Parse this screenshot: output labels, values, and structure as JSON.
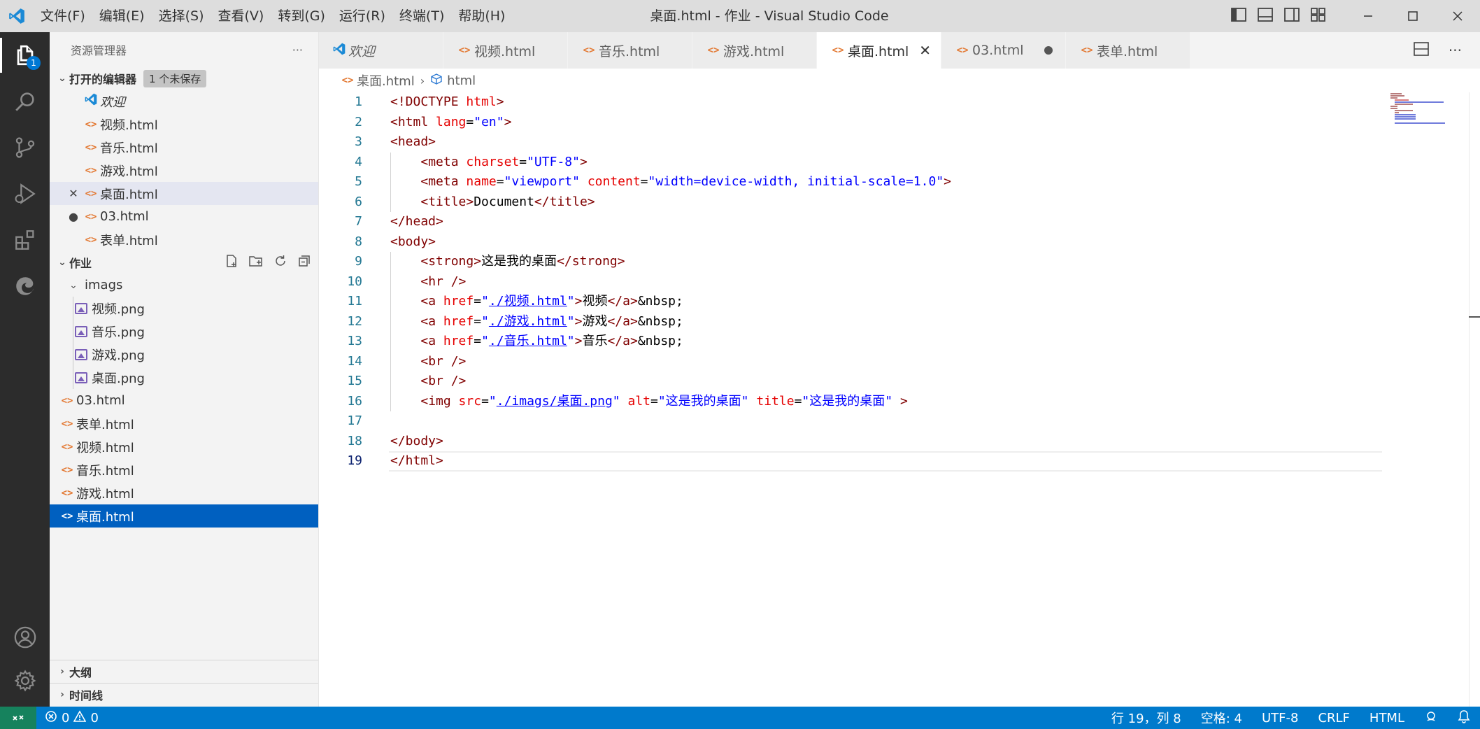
{
  "window": {
    "title": "桌面.html - 作业 - Visual Studio Code",
    "menu": [
      "文件(F)",
      "编辑(E)",
      "选择(S)",
      "查看(V)",
      "转到(G)",
      "运行(R)",
      "终端(T)",
      "帮助(H)"
    ]
  },
  "activity": {
    "explorer_badge": "1"
  },
  "sidebar": {
    "header": "资源管理器",
    "more": "···",
    "open_editors": {
      "title": "打开的编辑器",
      "badge": "1 个未保存",
      "items": [
        {
          "label": "欢迎",
          "type": "welcome"
        },
        {
          "label": "视频.html",
          "type": "html"
        },
        {
          "label": "音乐.html",
          "type": "html"
        },
        {
          "label": "游戏.html",
          "type": "html"
        },
        {
          "label": "桌面.html",
          "type": "html",
          "state": "close"
        },
        {
          "label": "03.html",
          "type": "html",
          "state": "dirty"
        },
        {
          "label": "表单.html",
          "type": "html"
        }
      ]
    },
    "workspace": {
      "title": "作业",
      "folder": "imags",
      "images": [
        "视频.png",
        "音乐.png",
        "游戏.png",
        "桌面.png"
      ],
      "files": [
        "03.html",
        "表单.html",
        "视频.html",
        "音乐.html",
        "游戏.html",
        "桌面.html"
      ]
    },
    "outline": "大纲",
    "timeline": "时间线"
  },
  "tabs": [
    {
      "label": "欢迎",
      "type": "welcome"
    },
    {
      "label": "视频.html",
      "type": "html"
    },
    {
      "label": "音乐.html",
      "type": "html"
    },
    {
      "label": "游戏.html",
      "type": "html"
    },
    {
      "label": "桌面.html",
      "type": "html",
      "active": true
    },
    {
      "label": "03.html",
      "type": "html",
      "dirty": true
    },
    {
      "label": "表单.html",
      "type": "html"
    }
  ],
  "breadcrumb": {
    "file": "桌面.html",
    "symbol": "html"
  },
  "editor": {
    "current_line": 19,
    "lines": [
      [
        [
          "t-tag",
          "<!DOCTYPE "
        ],
        [
          "t-attr",
          "html"
        ],
        [
          "t-tag",
          ">"
        ]
      ],
      [
        [
          "t-tag",
          "<html "
        ],
        [
          "t-attr",
          "lang"
        ],
        [
          "t-txt",
          "="
        ],
        [
          "t-str",
          "\"en\""
        ],
        [
          "t-tag",
          ">"
        ]
      ],
      [
        [
          "t-tag",
          "<head>"
        ]
      ],
      [
        [
          "t-txt",
          "    "
        ],
        [
          "t-tag",
          "<meta "
        ],
        [
          "t-attr",
          "charset"
        ],
        [
          "t-txt",
          "="
        ],
        [
          "t-str",
          "\"UTF-8\""
        ],
        [
          "t-tag",
          ">"
        ]
      ],
      [
        [
          "t-txt",
          "    "
        ],
        [
          "t-tag",
          "<meta "
        ],
        [
          "t-attr",
          "name"
        ],
        [
          "t-txt",
          "="
        ],
        [
          "t-str",
          "\"viewport\""
        ],
        [
          "t-txt",
          " "
        ],
        [
          "t-attr",
          "content"
        ],
        [
          "t-txt",
          "="
        ],
        [
          "t-str",
          "\"width=device-width, initial-scale=1.0\""
        ],
        [
          "t-tag",
          ">"
        ]
      ],
      [
        [
          "t-txt",
          "    "
        ],
        [
          "t-tag",
          "<title>"
        ],
        [
          "t-txt",
          "Document"
        ],
        [
          "t-tag",
          "</title>"
        ]
      ],
      [
        [
          "t-tag",
          "</head>"
        ]
      ],
      [
        [
          "t-tag",
          "<body>"
        ]
      ],
      [
        [
          "t-txt",
          "    "
        ],
        [
          "t-tag",
          "<strong>"
        ],
        [
          "t-txt",
          "这是我的桌面"
        ],
        [
          "t-tag",
          "</strong>"
        ]
      ],
      [
        [
          "t-txt",
          "    "
        ],
        [
          "t-tag",
          "<hr />"
        ]
      ],
      [
        [
          "t-txt",
          "    "
        ],
        [
          "t-tag",
          "<a "
        ],
        [
          "t-attr",
          "href"
        ],
        [
          "t-txt",
          "="
        ],
        [
          "t-str",
          "\""
        ],
        [
          "t-link",
          "./视频.html"
        ],
        [
          "t-str",
          "\""
        ],
        [
          "t-tag",
          ">"
        ],
        [
          "t-txt",
          "视频"
        ],
        [
          "t-tag",
          "</a>"
        ],
        [
          "t-txt",
          "&nbsp;"
        ]
      ],
      [
        [
          "t-txt",
          "    "
        ],
        [
          "t-tag",
          "<a "
        ],
        [
          "t-attr",
          "href"
        ],
        [
          "t-txt",
          "="
        ],
        [
          "t-str",
          "\""
        ],
        [
          "t-link",
          "./游戏.html"
        ],
        [
          "t-str",
          "\""
        ],
        [
          "t-tag",
          ">"
        ],
        [
          "t-txt",
          "游戏"
        ],
        [
          "t-tag",
          "</a>"
        ],
        [
          "t-txt",
          "&nbsp;"
        ]
      ],
      [
        [
          "t-txt",
          "    "
        ],
        [
          "t-tag",
          "<a "
        ],
        [
          "t-attr",
          "href"
        ],
        [
          "t-txt",
          "="
        ],
        [
          "t-str",
          "\""
        ],
        [
          "t-link",
          "./音乐.html"
        ],
        [
          "t-str",
          "\""
        ],
        [
          "t-tag",
          ">"
        ],
        [
          "t-txt",
          "音乐"
        ],
        [
          "t-tag",
          "</a>"
        ],
        [
          "t-txt",
          "&nbsp;"
        ]
      ],
      [
        [
          "t-txt",
          "    "
        ],
        [
          "t-tag",
          "<br />"
        ]
      ],
      [
        [
          "t-txt",
          "    "
        ],
        [
          "t-tag",
          "<br />"
        ]
      ],
      [
        [
          "t-txt",
          "    "
        ],
        [
          "t-tag",
          "<img "
        ],
        [
          "t-attr",
          "src"
        ],
        [
          "t-txt",
          "="
        ],
        [
          "t-str",
          "\""
        ],
        [
          "t-link",
          "./imags/桌面.png"
        ],
        [
          "t-str",
          "\""
        ],
        [
          "t-txt",
          " "
        ],
        [
          "t-attr",
          "alt"
        ],
        [
          "t-txt",
          "="
        ],
        [
          "t-str",
          "\"这是我的桌面\""
        ],
        [
          "t-txt",
          " "
        ],
        [
          "t-attr",
          "title"
        ],
        [
          "t-txt",
          "="
        ],
        [
          "t-str",
          "\"这是我的桌面\""
        ],
        [
          "t-txt",
          " "
        ],
        [
          "t-tag",
          ">"
        ]
      ],
      [],
      [
        [
          "t-tag",
          "</body>"
        ]
      ],
      [
        [
          "t-tag",
          "</html>"
        ]
      ]
    ]
  },
  "status": {
    "errors": "0",
    "warnings": "0",
    "position": "行 19，列 8",
    "spaces": "空格: 4",
    "encoding": "UTF-8",
    "eol": "CRLF",
    "language": "HTML"
  },
  "colors": {
    "statusbar": "#007acc",
    "activitybar": "#2c2c2c",
    "selection": "#0060c0"
  }
}
